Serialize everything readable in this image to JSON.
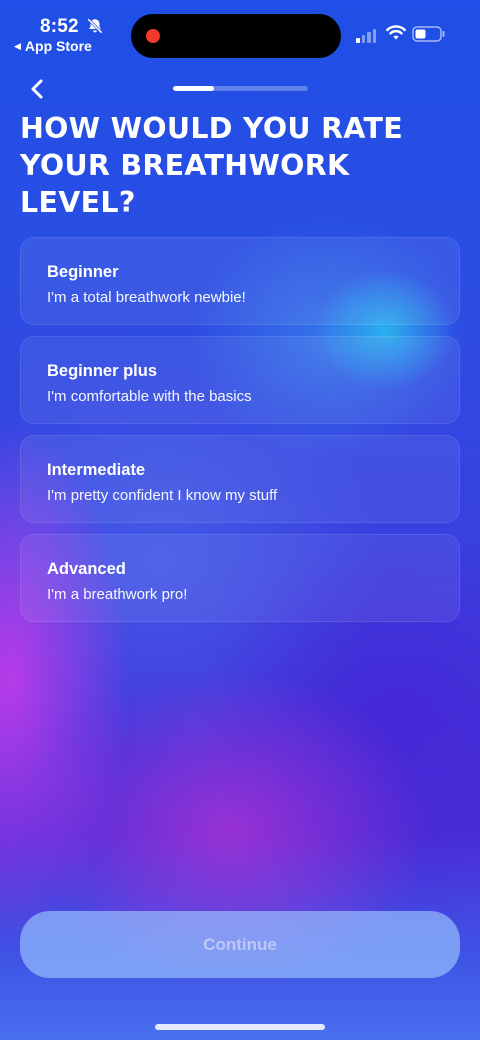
{
  "status_bar": {
    "time": "8:52",
    "back_app_label": "App Store",
    "icons": [
      "bell-slash-icon",
      "cellular-signal-icon",
      "wifi-icon",
      "battery-icon"
    ],
    "signal_bars_on": 1,
    "signal_bars_total": 4
  },
  "navigation": {
    "back_icon": "chevron-left-icon",
    "progress_fraction": 0.3
  },
  "title": "HOW WOULD YOU RATE YOUR BREATHWORK LEVEL?",
  "options": [
    {
      "title": "Beginner",
      "description": "I'm a total breathwork newbie!"
    },
    {
      "title": "Beginner plus",
      "description": "I'm comfortable with the basics"
    },
    {
      "title": "Intermediate",
      "description": "I'm pretty confident I know my stuff"
    },
    {
      "title": "Advanced",
      "description": "I'm a breathwork pro!"
    }
  ],
  "continue_label": "Continue",
  "colors": {
    "background_top": "#1f4fe6",
    "background_bottom": "#4a30d8",
    "recording_dot": "#f23a2c",
    "continue_button": "#a0cdff"
  }
}
